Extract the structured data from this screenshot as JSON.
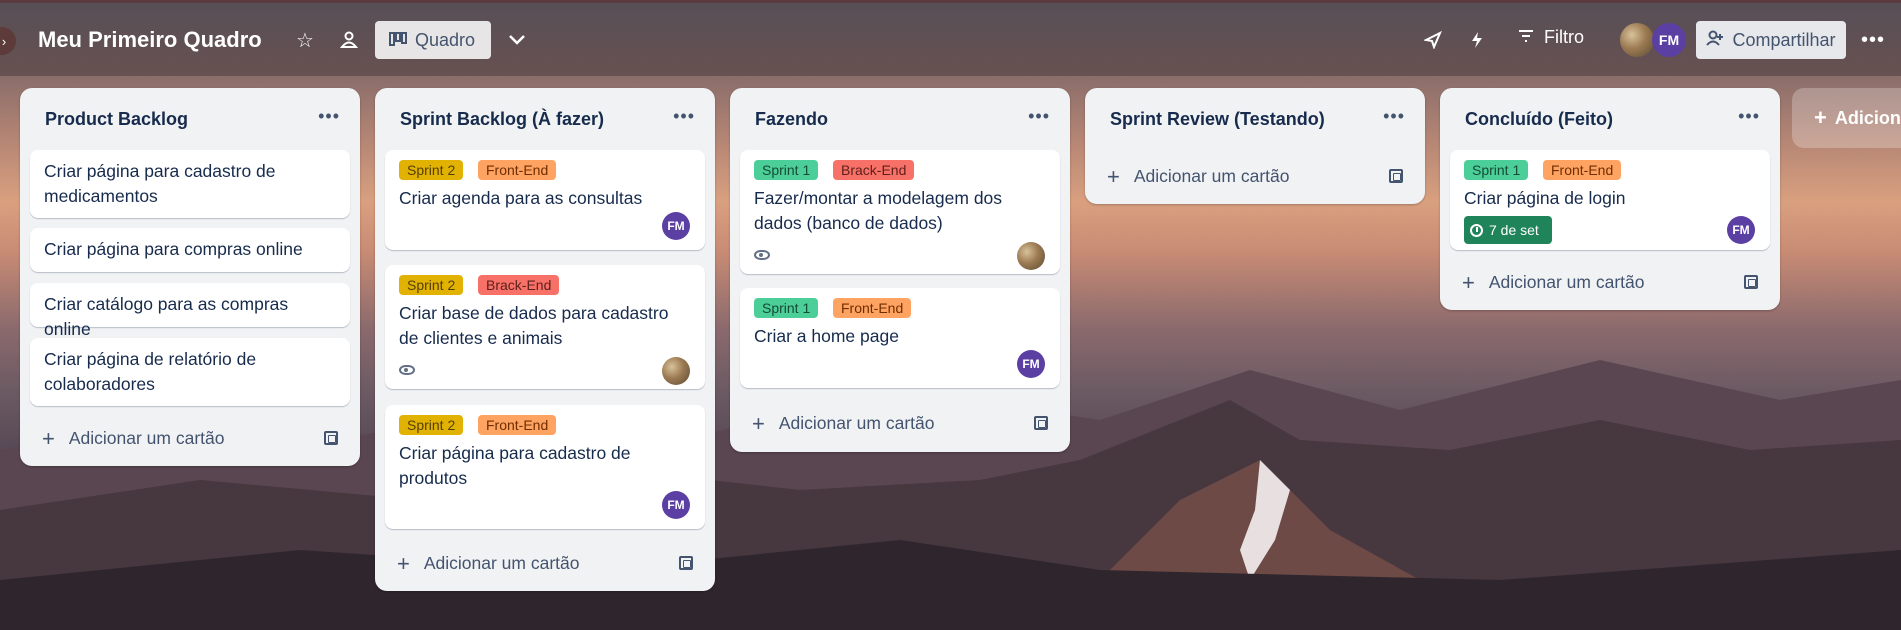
{
  "header": {
    "board_title": "Meu Primeiro Quadro",
    "view_label": "Quadro",
    "filter_label": "Filtro",
    "share_label": "Compartilhar",
    "member_initials": "FM"
  },
  "lists": [
    {
      "title": "Product Backlog",
      "cards": [
        {
          "text": "Criar página para cadastro de medicamentos"
        },
        {
          "text": "Criar página para compras online"
        },
        {
          "text": "Criar catálogo para as compras online"
        },
        {
          "text": "Criar página de relatório de colaboradores"
        }
      ],
      "add_card_label": "Adicionar um cartão"
    },
    {
      "title": "Sprint Backlog (À fazer)",
      "cards": [
        {
          "labels": [
            "Sprint 2",
            "Front-End"
          ],
          "text": "Criar agenda para as consultas",
          "member": "FM"
        },
        {
          "labels": [
            "Sprint 2",
            "Brack-End"
          ],
          "text": "Criar base de dados para cadastro de clientes e animais",
          "watch": true
        },
        {
          "labels": [
            "Sprint 2",
            "Front-End"
          ],
          "text": "Criar página para cadastro de produtos",
          "member": "FM"
        }
      ],
      "add_card_label": "Adicionar um cartão"
    },
    {
      "title": "Fazendo",
      "cards": [
        {
          "labels": [
            "Sprint 1",
            "Brack-End"
          ],
          "text": "Fazer/montar a modelagem dos dados (banco de dados)",
          "watch": true
        },
        {
          "labels": [
            "Sprint 1",
            "Front-End"
          ],
          "text": "Criar a home page",
          "member": "FM"
        }
      ],
      "add_card_label": "Adicionar um cartão"
    },
    {
      "title": "Sprint Review (Testando)",
      "cards": [],
      "add_card_label": "Adicionar um cartão"
    },
    {
      "title": "Concluído (Feito)",
      "cards": [
        {
          "labels": [
            "Sprint 1",
            "Front-End"
          ],
          "text": "Criar página de login",
          "due": "7 de set",
          "member": "FM"
        }
      ],
      "add_card_label": "Adicionar um cartão"
    }
  ],
  "add_list_label": "Adiciona",
  "colors": {
    "label_green": "#4bce97",
    "label_yellow": "#e2b203",
    "label_orange": "#fea362",
    "label_red": "#f87168",
    "member_avatar": "#5b3fa3",
    "due_badge": "#1f845a"
  },
  "icons": [
    "star-icon",
    "people-icon",
    "board-icon",
    "chevron-down-icon",
    "rocket-icon",
    "lightning-icon",
    "filter-icon",
    "add-person-icon",
    "more-icon",
    "eye-icon",
    "template-icon",
    "clock-icon",
    "plus-icon"
  ]
}
